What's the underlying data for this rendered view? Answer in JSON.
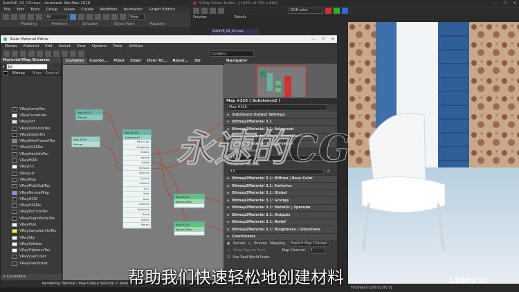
{
  "max": {
    "title": "Sub2VR_02_03.max - Autodesk 3ds Max 2018",
    "menus": [
      "File",
      "Edit",
      "Tools",
      "Group",
      "Views",
      "Create",
      "Modifiers",
      "Animation",
      "Graph Editors"
    ],
    "toolbar_dd": "All",
    "view_dd": "View",
    "ribbon": [
      "Modeling",
      "Freeform",
      "Selection",
      "Object Paint",
      "Populate"
    ]
  },
  "vfb": {
    "title": "V-Ray frame buffer - [100% of 720 x 800]",
    "color_dd": "RGB color",
    "tabs": [
      "Preview",
      "Details"
    ],
    "file": "Sub2VR_02_03.max",
    "status": "Finished in [00:01:00.5]"
  },
  "sme": {
    "title": "Slate Material Editor",
    "menus": [
      "Modes",
      "Material",
      "Edit",
      "Select",
      "View",
      "Options",
      "Tools",
      "Utilities"
    ],
    "view_dd": "Curtains",
    "browser_title": "Material/Map Browser",
    "search": "bit",
    "bitmap": "Bitmap",
    "bitmap_right": "Maps - General",
    "items": [
      "VRayCompTex",
      "VRayCurvature",
      "VRayDirt",
      "VRayDistanceTex",
      "VRayEdgesTex",
      "VRayFakeFresnelTex",
      "VRayGLSLTex",
      "VRayHairInfoTex",
      "VRayHDRI",
      "VRayICC",
      "VRayLut",
      "VRayMap",
      "VRayMultiSubTex",
      "VRayNormalMap",
      "VRayOCIO",
      "VRayOSLTex",
      "VRayParticleTex",
      "VRayPluginNodeTex",
      "VRayPtex",
      "VRaySamplerInfoTex",
      "VRaySky",
      "VRaySoftbox",
      "VRayTriplanarTex",
      "VRayUserColor",
      "VRayUserScalar"
    ],
    "controllers": "+ Controllers",
    "view_tabs": [
      "Curtains",
      "Cushio...",
      "Floor",
      "Chair",
      "Over Ri...",
      "Room...",
      "Str"
    ],
    "status": "Rendering \"Normal ( Map Output Selector )\" done"
  },
  "nodes": {
    "a": "Map #323",
    "a2": "Bitmap",
    "b": "Map #320",
    "b2": "Bitmap",
    "c": "Map #326",
    "c2": "Substance2",
    "d": "Map #321",
    "d2": "Normal Map",
    "e": "Map #322",
    "e2": "Normal Map",
    "rows": [
      "Base Color",
      "Roughness",
      "Metallic",
      "Normal",
      "Height",
      "Emissive",
      "Specular",
      "Opacity",
      "Ambient",
      "Occl.",
      "Mask",
      "Displ.",
      "Specular",
      "Glossiness",
      "Bump",
      "Diffuse",
      "Refract"
    ]
  },
  "nav": {
    "title": "Navigator"
  },
  "props": {
    "header": "Map #326 ( Substance2 )",
    "name": "Map #326",
    "rollouts": [
      "Substance Output Settings",
      "Bitmap2Material 3.1",
      "Bitmap2Material 3.1: Advanced",
      "Bitmap2Material 3.1: Ambient Occlusion",
      "Bitmap2Material 3.1: Curvature"
    ],
    "curv_int": "Curvature Intensity",
    "curv_int_v": "0.0",
    "curv_den": "Curvature Denoise",
    "curv_den_v": "0.0",
    "rollouts2": [
      "Bitmap2Material 3.1: Diffuse | Base Color",
      "Bitmap2Material 3.1: Emissive",
      "Bitmap2Material 3.1: Global",
      "Bitmap2Material 3.1: Grunge",
      "Bitmap2Material 3.1: Metallic | Specular",
      "Bitmap2Material 3.1: Outputs",
      "Bitmap2Material 3.1: Relief",
      "Bitmap2Material 3.1: Roughness | Glossiness"
    ],
    "coords": "Coordinates",
    "texture": "Texture",
    "environ": "Environ",
    "mapping_l": "Mapping:",
    "mapping": "Explicit Map Channel",
    "show_map": "Show Map on Back",
    "map_channel_l": "Map Channel:",
    "map_channel": "1",
    "real_world": "Use Real-World Scale"
  },
  "watermark": "永速的CG",
  "subtitle": "帮助我们快速轻松地创建材料",
  "logo": "Linked in"
}
